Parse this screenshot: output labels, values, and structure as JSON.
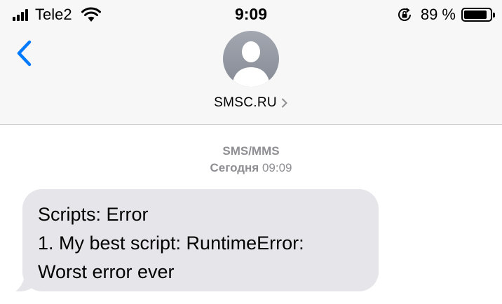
{
  "status_bar": {
    "carrier": "Tele2",
    "time": "9:09",
    "battery_percent": "89 %",
    "battery_level": 0.89
  },
  "nav": {
    "contact_name": "SMSC.RU",
    "back_icon": "chevron-left-icon",
    "avatar_icon": "person-silhouette-icon"
  },
  "thread": {
    "service": "SMS/MMS",
    "date_day": "Сегодня",
    "date_time": "09:09"
  },
  "message": {
    "lines": [
      "Scripts: Error",
      "1. My best script: RuntimeError:",
      "Worst error ever"
    ]
  },
  "colors": {
    "accent": "#007aff",
    "bubble": "#e5e5ea",
    "header": "#f7f7f7",
    "meta_text": "#8e8e93"
  }
}
